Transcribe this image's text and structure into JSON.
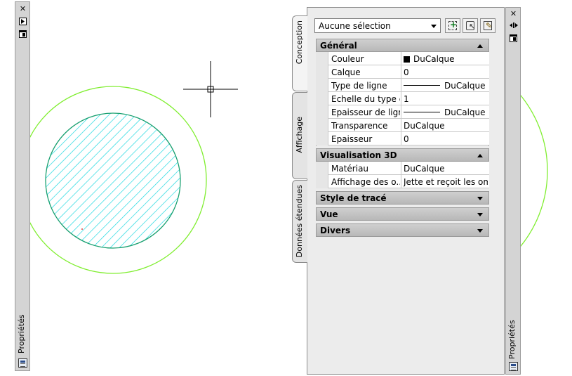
{
  "left_strip": {
    "close_label": "✕",
    "label": "Propriétés"
  },
  "right_strip": {
    "close_label": "✕",
    "label": "Propriétés"
  },
  "tabs": [
    {
      "label": "Conception",
      "active": true
    },
    {
      "label": "Affichage",
      "active": false
    },
    {
      "label": "Données étendues",
      "active": false
    }
  ],
  "selector": {
    "value": "Aucune sélection"
  },
  "tool_icons": [
    "toggle-pickadd-icon",
    "select-objects-icon",
    "quick-select-icon"
  ],
  "groups": {
    "general": {
      "title": "Général",
      "rows": [
        {
          "name": "Couleur",
          "value": "DuCalque"
        },
        {
          "name": "Calque",
          "value": "0"
        },
        {
          "name": "Type de ligne",
          "value": "DuCalque"
        },
        {
          "name": "Echelle du type d...",
          "value": "1"
        },
        {
          "name": "Epaisseur de ligne",
          "value": "DuCalque"
        },
        {
          "name": "Transparence",
          "value": "DuCalque"
        },
        {
          "name": "Epaisseur",
          "value": "0"
        }
      ]
    },
    "vis3d": {
      "title": "Visualisation 3D",
      "rows": [
        {
          "name": "Matériau",
          "value": "DuCalque"
        },
        {
          "name": "Affichage des o...",
          "value": "Jette et reçoit les om..."
        }
      ]
    },
    "style": {
      "title": "Style de tracé"
    },
    "vue": {
      "title": "Vue"
    },
    "divers": {
      "title": "Divers"
    }
  },
  "colors": {
    "outer_circle": "#80ee30",
    "inner_circle": "#18a070",
    "hatch": "#20d8e0",
    "panel": "#ececec",
    "group_header": "#c4c4c4"
  }
}
